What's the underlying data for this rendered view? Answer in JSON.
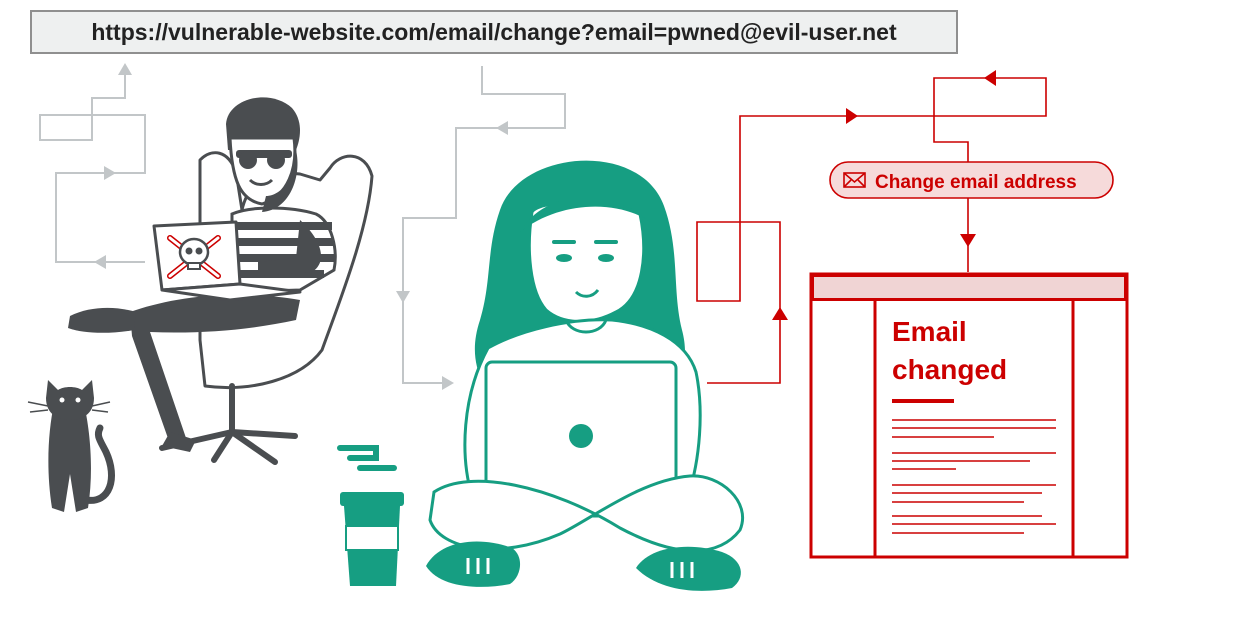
{
  "url": {
    "text": "https://vulnerable-website.com/email/change?email=pwned@evil-user.net"
  },
  "request": {
    "label": "Change email address",
    "icon": "envelope-icon"
  },
  "response": {
    "line1": "Email",
    "line2": "changed"
  },
  "colors": {
    "attacker": "#4a4d50",
    "victim": "#169e82",
    "request": "#cc0000",
    "flow_gray": "#c2c6c8",
    "pill_fill": "#f6dada",
    "header_fill": "#f0d4d4"
  }
}
